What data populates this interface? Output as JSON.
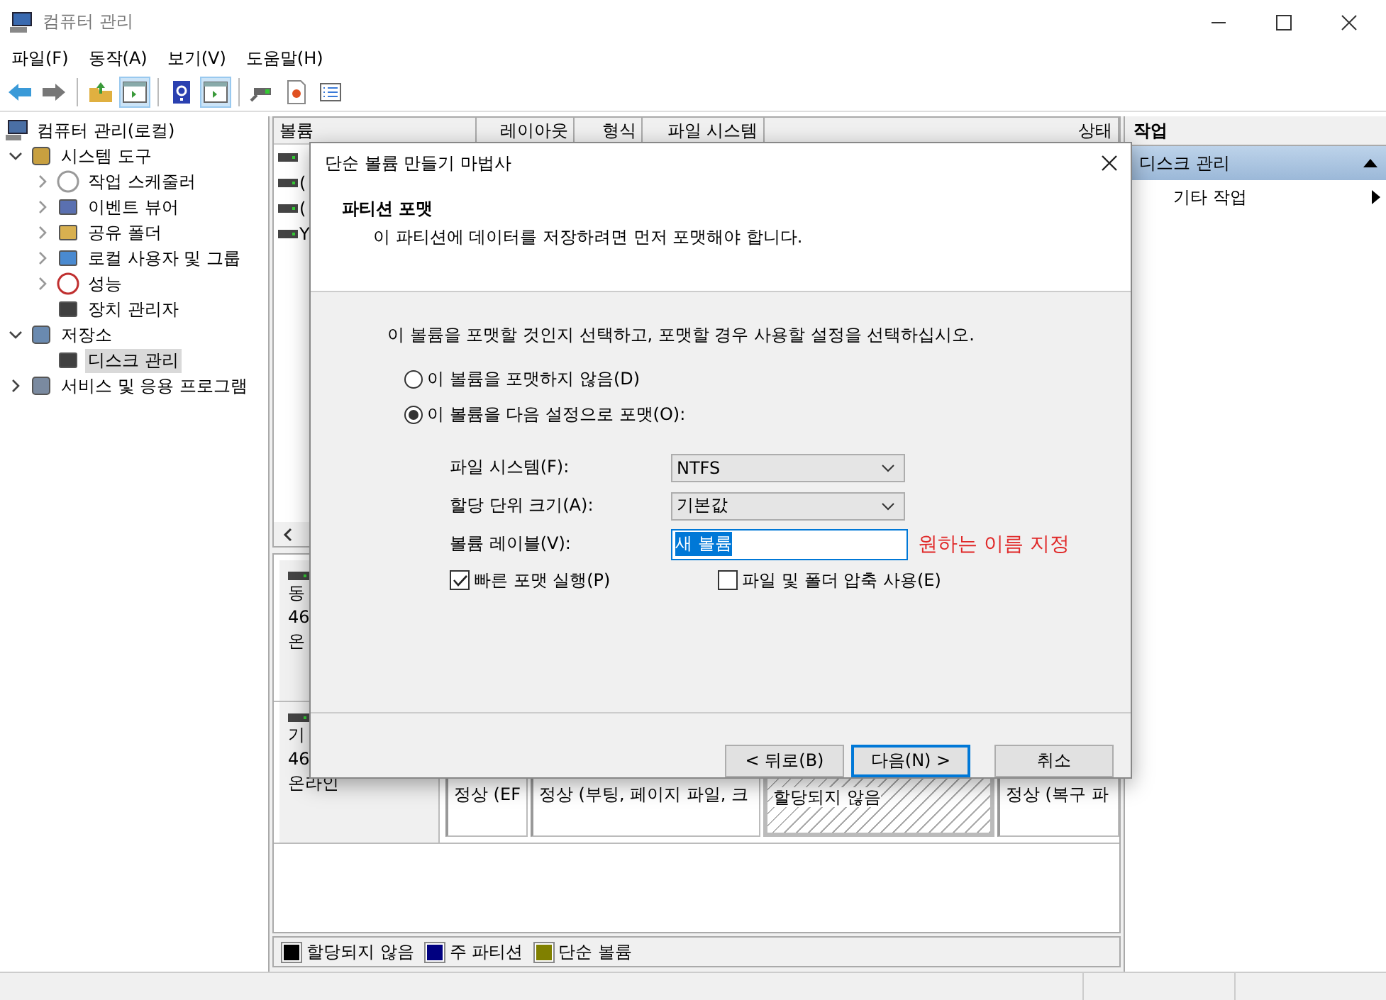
{
  "window": {
    "title": "컴퓨터 관리"
  },
  "menu": [
    "파일(F)",
    "동작(A)",
    "보기(V)",
    "도움말(H)"
  ],
  "toolbar": [
    {
      "kind": "back",
      "pressed": false
    },
    {
      "kind": "forward",
      "pressed": false
    },
    {
      "kind": "separator"
    },
    {
      "kind": "up",
      "pressed": false
    },
    {
      "kind": "tree",
      "pressed": true
    },
    {
      "kind": "separator"
    },
    {
      "kind": "help",
      "pressed": false
    },
    {
      "kind": "pane",
      "pressed": true
    },
    {
      "kind": "separator"
    },
    {
      "kind": "connect",
      "pressed": false
    },
    {
      "kind": "check",
      "pressed": false
    },
    {
      "kind": "list",
      "pressed": false
    }
  ],
  "tree": [
    {
      "label": "컴퓨터 관리(로컬)",
      "kind": "computer",
      "selected": false,
      "children": [
        {
          "label": "시스템 도구",
          "kind": "tools",
          "expanded": true,
          "selected": false,
          "children": [
            {
              "label": "작업 스케줄러",
              "kind": "clock",
              "expanded": false,
              "selected": false
            },
            {
              "label": "이벤트 뷰어",
              "kind": "event",
              "expanded": false,
              "selected": false
            },
            {
              "label": "공유 폴더",
              "kind": "share",
              "expanded": false,
              "selected": false
            },
            {
              "label": "로컬 사용자 및 그룹",
              "kind": "users",
              "expanded": false,
              "selected": false
            },
            {
              "label": "성능",
              "kind": "perf",
              "expanded": false,
              "selected": false
            },
            {
              "label": "장치 관리자",
              "kind": "device",
              "selected": false
            }
          ]
        },
        {
          "label": "저장소",
          "kind": "storage",
          "expanded": true,
          "selected": false,
          "children": [
            {
              "label": "디스크 관리",
              "kind": "disk",
              "selected": true
            }
          ]
        },
        {
          "label": "서비스 및 응용 프로그램",
          "kind": "services",
          "expanded": false,
          "selected": false
        }
      ]
    }
  ],
  "volume_table": {
    "columns": [
      "볼륨",
      "레이아웃",
      "형식",
      "파일 시스템",
      "상태"
    ],
    "rows": [
      {
        "kind": "volume"
      },
      {
        "kind": "volume",
        "name": "("
      },
      {
        "kind": "volume",
        "name": "("
      },
      {
        "kind": "volume",
        "name": "Y"
      }
    ]
  },
  "disks": [
    {
      "lines": [
        "동",
        "46",
        "온"
      ]
    },
    {
      "lines": [
        "기",
        "46",
        "온라인"
      ],
      "partitions": [
        {
          "label": "정상 (EF",
          "kind": "normal",
          "selected": false
        },
        {
          "label": "정상 (부팅, 페이지 파일, 크",
          "kind": "normal",
          "selected": false
        },
        {
          "label": "할당되지 않음",
          "kind": "unallocated",
          "selected": true
        },
        {
          "label": "정상 (복구 파",
          "kind": "normal",
          "selected": false
        }
      ]
    }
  ],
  "legend": [
    {
      "label": "할당되지 않음",
      "color": "#000000"
    },
    {
      "label": "주 파티션",
      "color": "#000080"
    },
    {
      "label": "단순 볼륨",
      "color": "#808000"
    }
  ],
  "actions": {
    "title": "작업",
    "sections": [
      {
        "label": "디스크 관리",
        "expanded": true,
        "items": [
          "기타 작업"
        ]
      }
    ]
  },
  "dialog": {
    "title": "단순 볼륨 만들기 마법사",
    "heading": "파티션 포맷",
    "subheading": "이 파티션에 데이터를 저장하려면 먼저 포맷해야 합니다.",
    "instruction": "이 볼륨을 포맷할 것인지 선택하고, 포맷할 경우 사용할 설정을 선택하십시오.",
    "options": [
      {
        "label": "이 볼륨을 포맷하지 않음(D)",
        "selected": false
      },
      {
        "label": "이 볼륨을 다음 설정으로 포맷(O):",
        "selected": true
      }
    ],
    "fields": [
      {
        "label": "파일 시스템(F):",
        "kind": "dropdown",
        "value": "NTFS"
      },
      {
        "label": "할당 단위 크기(A):",
        "kind": "dropdown",
        "value": "기본값"
      },
      {
        "label": "볼륨 레이블(V):",
        "kind": "text",
        "value": "새 볼륨",
        "highlighted": true,
        "annotation": "원하는 이름 지정"
      }
    ],
    "checkboxes": [
      {
        "label": "빠른 포맷 실행(P)",
        "checked": true
      },
      {
        "label": "파일 및 폴더 압축 사용(E)",
        "checked": false
      }
    ],
    "buttons": [
      {
        "label": "< 뒤로(B)",
        "focused": false
      },
      {
        "label": "다음(N) >",
        "focused": true
      },
      {
        "label": "취소",
        "focused": false
      }
    ]
  }
}
